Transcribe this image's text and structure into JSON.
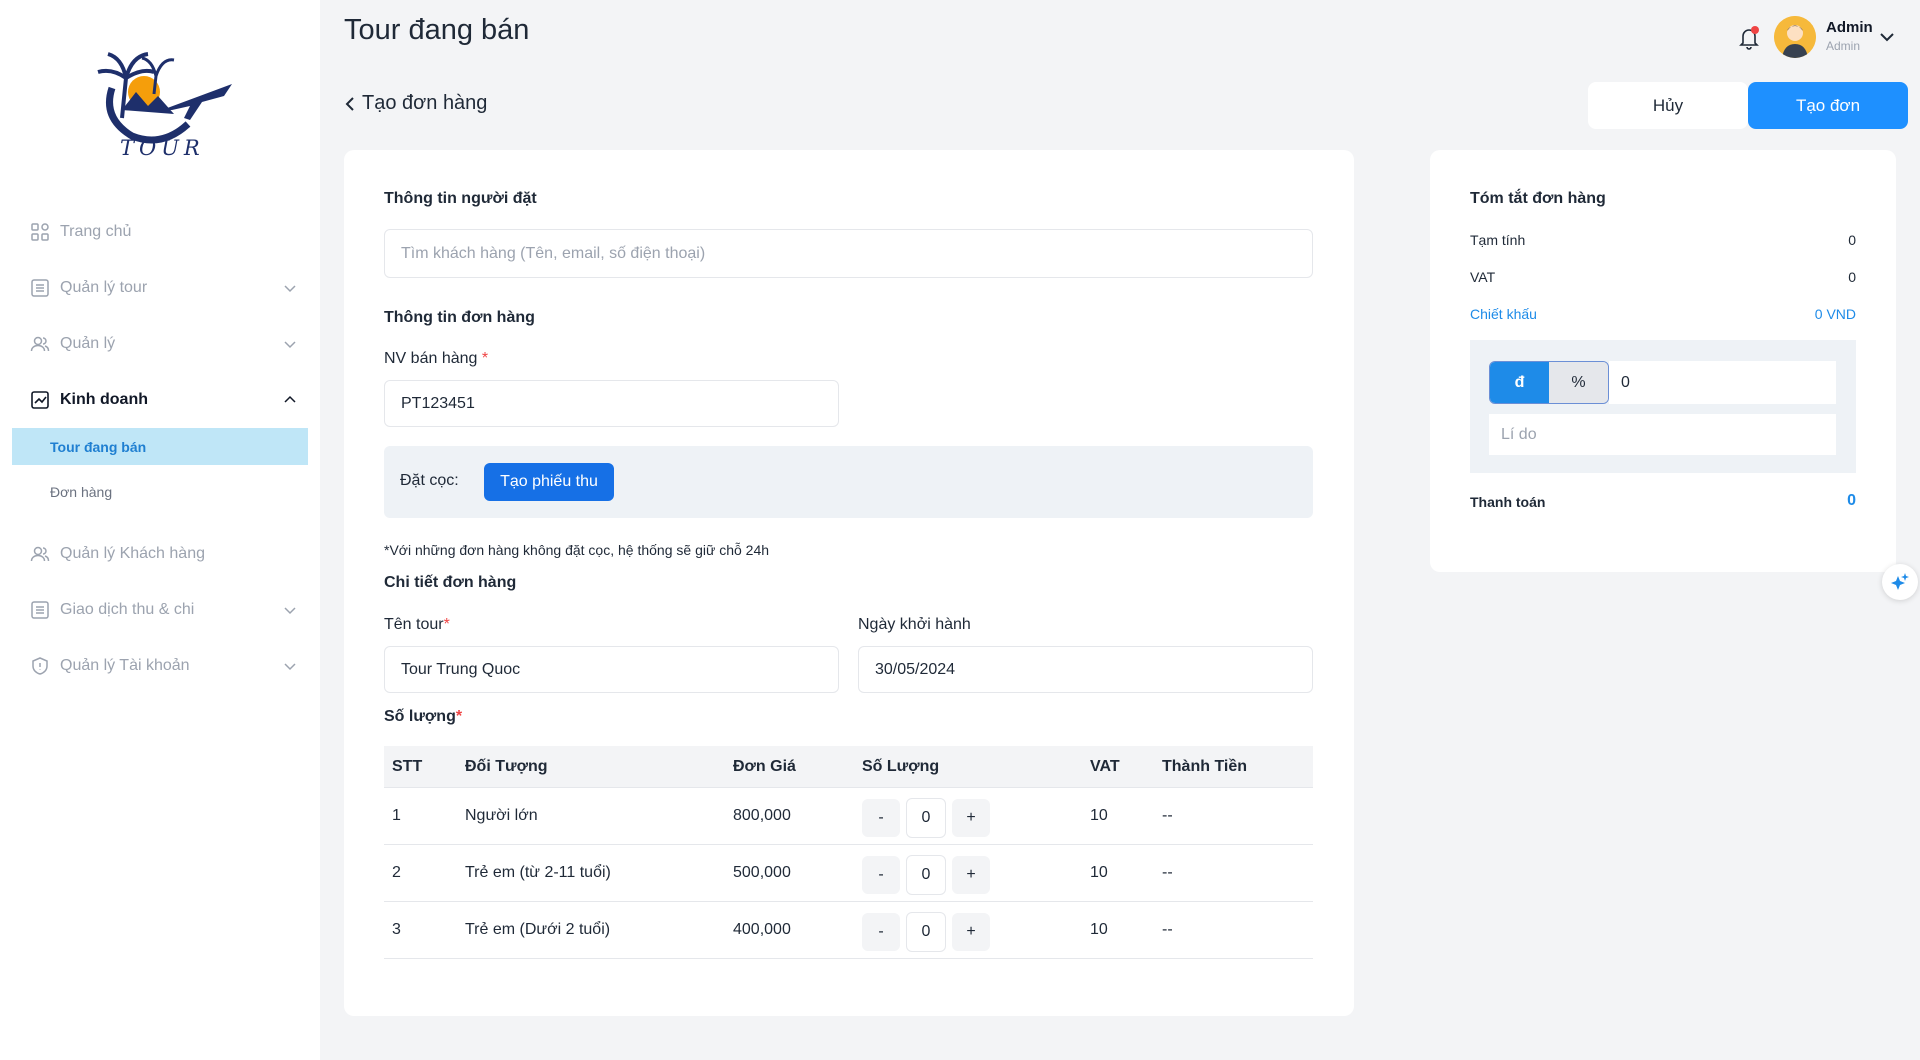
{
  "brand": {
    "logo_text": "TOUR"
  },
  "sidebar": {
    "items": [
      {
        "label": "Trang chủ",
        "icon": "grid-icon"
      },
      {
        "label": "Quản lý tour",
        "icon": "list-icon"
      },
      {
        "label": "Quản lý",
        "icon": "users-icon"
      },
      {
        "label": "Kinh doanh",
        "icon": "chart-icon"
      },
      {
        "label": "Quản lý Khách hàng",
        "icon": "users-icon"
      },
      {
        "label": "Giao dịch thu & chi",
        "icon": "list-icon"
      },
      {
        "label": "Quản lý Tài khoản",
        "icon": "shield-icon"
      }
    ],
    "subitems": [
      {
        "label": "Tour đang bán",
        "active": true
      },
      {
        "label": "Đơn hàng",
        "active": false
      }
    ]
  },
  "header": {
    "title": "Tour đang bán",
    "user": {
      "name": "Admin",
      "role": "Admin"
    }
  },
  "actions": {
    "back_label": "Tạo đơn hàng",
    "cancel_label": "Hủy",
    "create_label": "Tạo đơn"
  },
  "form": {
    "customer_section": "Thông tin người đặt",
    "customer_search_placeholder": "Tìm khách hàng (Tên, email, số điện thoại)",
    "order_section": "Thông tin đơn hàng",
    "sales_label": "NV bán hàng",
    "sales_value": "PT123451",
    "deposit_label": "Đặt cọc:",
    "receipt_button": "Tạo phiếu thu",
    "note": "*Với những đơn hàng không đặt cọc, hệ thống sẽ giữ chỗ 24h",
    "detail_section": "Chi tiết đơn hàng",
    "tour_label": "Tên tour",
    "tour_value": "Tour Trung Quoc",
    "date_label": "Ngày khởi hành",
    "date_value": "30/05/2024",
    "qty_section": "Số lượng",
    "required_mark": "*"
  },
  "table": {
    "headers": [
      "STT",
      "Đối Tượng",
      "Đơn Giá",
      "Số Lượng",
      "VAT",
      "Thành Tiền"
    ],
    "rows": [
      {
        "stt": "1",
        "target": "Người lớn",
        "price": "800,000",
        "qty": "0",
        "vat": "10",
        "total": "--"
      },
      {
        "stt": "2",
        "target": "Trẻ em (từ 2-11 tuổi)",
        "price": "500,000",
        "qty": "0",
        "vat": "10",
        "total": "--"
      },
      {
        "stt": "3",
        "target": "Trẻ em (Dưới 2 tuổi)",
        "price": "400,000",
        "qty": "0",
        "vat": "10",
        "total": "--"
      }
    ],
    "minus": "-",
    "plus": "+"
  },
  "summary": {
    "title": "Tóm tắt đơn hàng",
    "subtotal_label": "Tạm tính",
    "subtotal_value": "0",
    "vat_label": "VAT",
    "vat_value": "0",
    "discount_label": "Chiết khấu",
    "discount_value": "0 VND",
    "seg_currency": "đ",
    "seg_percent": "%",
    "discount_input": "0",
    "reason_placeholder": "Lí do",
    "payment_label": "Thanh toán",
    "payment_value": "0"
  },
  "colors": {
    "accent": "#1e90ff",
    "active_bg": "#bfe6f7",
    "required": "#ef4444"
  }
}
